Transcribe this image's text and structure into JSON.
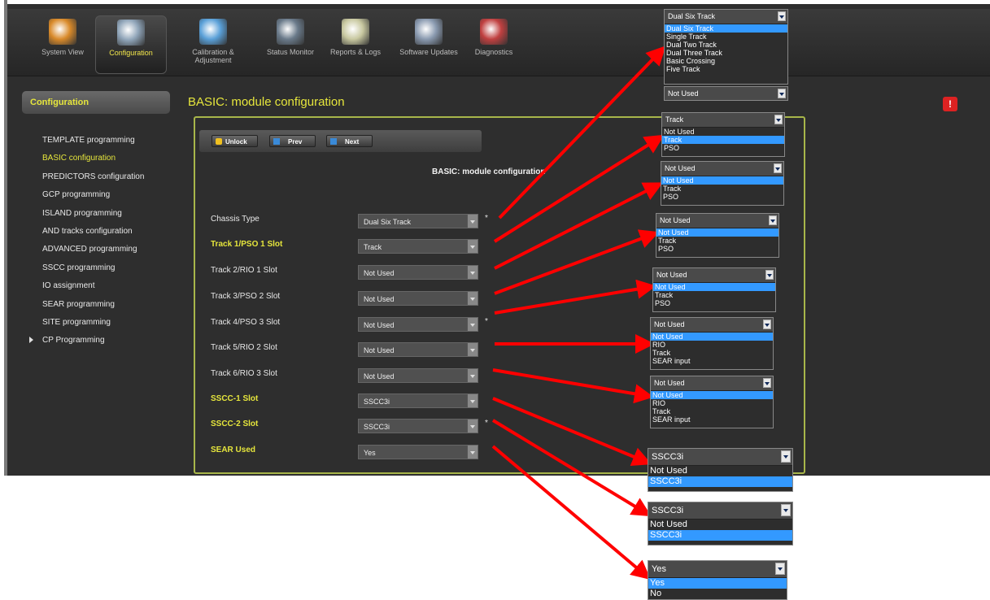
{
  "toolbar": {
    "items": [
      {
        "label": "System View",
        "icon": "house-icon"
      },
      {
        "label": "Configuration",
        "icon": "gears-icon"
      },
      {
        "label": "Calibration & Adjustment",
        "icon": "train-icon"
      },
      {
        "label": "Status Monitor",
        "icon": "monitor-icon"
      },
      {
        "label": "Reports & Logs",
        "icon": "report-icon"
      },
      {
        "label": "Software Updates",
        "icon": "wrench-icon"
      },
      {
        "label": "Diagnostics",
        "icon": "magnifier-icon"
      }
    ],
    "active_index": 1
  },
  "sidebar": {
    "header": "Configuration",
    "items": [
      {
        "label": "TEMPLATE programming"
      },
      {
        "label": "BASIC configuration"
      },
      {
        "label": "PREDICTORS configuration"
      },
      {
        "label": "GCP programming"
      },
      {
        "label": "ISLAND programming"
      },
      {
        "label": "AND tracks configuration"
      },
      {
        "label": "ADVANCED programming"
      },
      {
        "label": "SSCC programming"
      },
      {
        "label": "IO assignment"
      },
      {
        "label": "SEAR programming"
      },
      {
        "label": "SITE programming"
      },
      {
        "label": "CP Programming"
      }
    ],
    "selected_index": 1
  },
  "page": {
    "title": "BASIC: module configuration",
    "form_title": "BASIC: module configuration",
    "buttons": {
      "unlock": "Unlock",
      "prev": "Prev",
      "next": "Next"
    },
    "alert_icon": "!"
  },
  "form": {
    "fields": [
      {
        "label": "Chassis Type",
        "value": "Dual Six Track",
        "highlight": false,
        "star": true
      },
      {
        "label": "Track 1/PSO 1 Slot",
        "value": "Track",
        "highlight": true,
        "star": false
      },
      {
        "label": "Track 2/RIO 1 Slot",
        "value": "Not Used",
        "highlight": false,
        "star": false
      },
      {
        "label": "Track 3/PSO 2 Slot",
        "value": "Not Used",
        "highlight": false,
        "star": false
      },
      {
        "label": "Track 4/PSO 3 Slot",
        "value": "Not Used",
        "highlight": false,
        "star": true
      },
      {
        "label": "Track 5/RIO 2 Slot",
        "value": "Not Used",
        "highlight": false,
        "star": false
      },
      {
        "label": "Track 6/RIO 3 Slot",
        "value": "Not Used",
        "highlight": false,
        "star": false
      },
      {
        "label": "SSCC-1 Slot",
        "value": "SSCC3i",
        "highlight": true,
        "star": false
      },
      {
        "label": "SSCC-2 Slot",
        "value": "SSCC3i",
        "highlight": true,
        "star": true
      },
      {
        "label": "SEAR Used",
        "value": "Yes",
        "highlight": true,
        "star": false
      }
    ]
  },
  "dropdowns": [
    {
      "selected": "Dual Six Track",
      "options": [
        "Dual Six Track",
        "Single Track",
        "Dual Two Track",
        "Dual Three Track",
        "Basic Crossing",
        "Five Track"
      ],
      "highlight": 0
    },
    {
      "selected": "Not Used",
      "options": [],
      "highlight": -1
    },
    {
      "selected": "Track",
      "options": [
        "Not Used",
        "Track",
        "PSO"
      ],
      "highlight": 1
    },
    {
      "selected": "Not Used",
      "options": [
        "Not Used",
        "Track",
        "PSO"
      ],
      "highlight": 0
    },
    {
      "selected": "Not Used",
      "options": [
        "Not Used",
        "Track",
        "PSO"
      ],
      "highlight": 0
    },
    {
      "selected": "Not Used",
      "options": [
        "Not Used",
        "Track",
        "PSO"
      ],
      "highlight": 0
    },
    {
      "selected": "Not Used",
      "options": [
        "Not Used",
        "RIO",
        "Track",
        "SEAR input"
      ],
      "highlight": 0
    },
    {
      "selected": "Not Used",
      "options": [
        "Not Used",
        "RIO",
        "Track",
        "SEAR input"
      ],
      "highlight": 0
    },
    {
      "selected": "SSCC3i",
      "options": [
        "Not Used",
        "SSCC3i"
      ],
      "highlight": 1
    },
    {
      "selected": "SSCC3i",
      "options": [
        "Not Used",
        "SSCC3i"
      ],
      "highlight": 1
    },
    {
      "selected": "Yes",
      "options": [
        "Yes",
        "No"
      ],
      "highlight": 0
    }
  ],
  "colors": {
    "accent": "#e6e63c",
    "panel_border": "#a8b64a",
    "highlight": "#3399ff",
    "arrow": "#ff0000",
    "alert": "#dd2222"
  }
}
